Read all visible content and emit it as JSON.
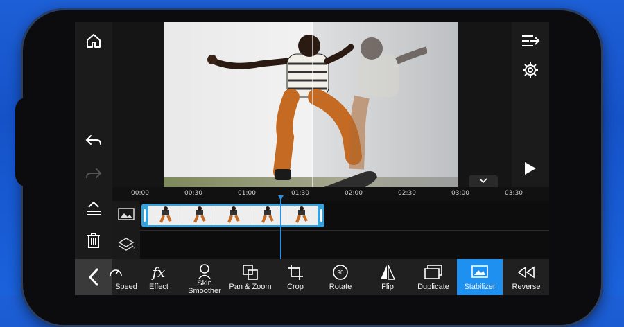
{
  "left_rail": {
    "home": "home-icon",
    "undo": "undo-icon",
    "redo": "redo-icon",
    "export": "upload-icon",
    "delete": "trash-icon"
  },
  "right_rail": {
    "produce": "export-icon",
    "settings": "gear-icon",
    "play": "play-icon"
  },
  "timeline": {
    "ticks": [
      "00:00",
      "00:30",
      "01:00",
      "01:30",
      "02:00",
      "02:30",
      "03:00",
      "03:30"
    ],
    "layer_count": "1"
  },
  "toolbar": {
    "back": "chevron-left-icon",
    "tools": [
      {
        "label": "Speed",
        "icon": "speed-icon"
      },
      {
        "label": "Effect",
        "icon": "fx-icon"
      },
      {
        "label": "Skin Smoother",
        "icon": "skin-icon"
      },
      {
        "label": "Pan & Zoom",
        "icon": "pan-zoom-icon"
      },
      {
        "label": "Crop",
        "icon": "crop-icon"
      },
      {
        "label": "Rotate",
        "icon": "rotate-icon",
        "badge": "90"
      },
      {
        "label": "Flip",
        "icon": "flip-icon"
      },
      {
        "label": "Duplicate",
        "icon": "duplicate-icon"
      },
      {
        "label": "Stabilizer",
        "icon": "stabilizer-icon",
        "active": true
      },
      {
        "label": "Reverse",
        "icon": "reverse-icon"
      }
    ]
  },
  "colors": {
    "accent": "#1e90f0",
    "clip": "#3aa0d8",
    "background": "#1552c8"
  }
}
